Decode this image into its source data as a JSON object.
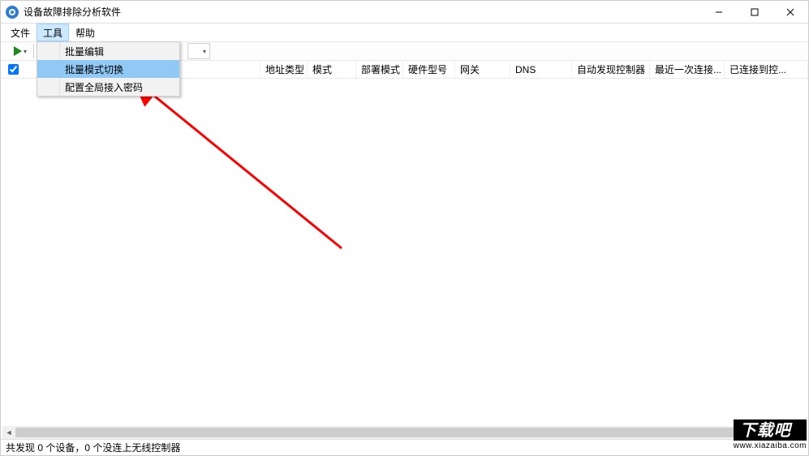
{
  "window": {
    "title": "设备故障排除分析软件"
  },
  "menubar": {
    "items": [
      "文件",
      "工具",
      "帮助"
    ],
    "open_index": 1
  },
  "dropdown": {
    "items": [
      "批量编辑",
      "批量模式切换",
      "配置全局接入密码"
    ],
    "hover_index": 1
  },
  "columns": {
    "c0": "地址类型",
    "c1": "模式",
    "c2": "部署模式",
    "c3": "硬件型号",
    "c4": "网关",
    "c5": "DNS",
    "c6": "自动发现控制器",
    "c7": "最近一次连接...",
    "c8": "已连接到控..."
  },
  "statusbar": {
    "text": "共发现 0 个设备，0 个没连上无线控制器"
  },
  "watermark": {
    "logo_text": "下载吧",
    "url": "www.xiazaiba.com"
  }
}
